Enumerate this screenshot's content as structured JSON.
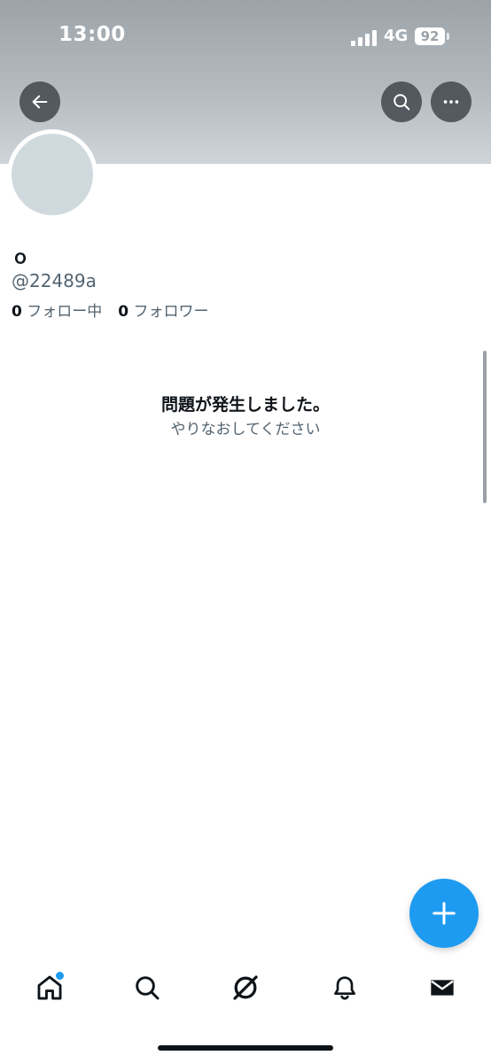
{
  "status_bar": {
    "time": "13:00",
    "network": "4G",
    "battery": "92"
  },
  "header": {
    "back_icon": "arrow-left-icon",
    "search_icon": "search-icon",
    "more_icon": "more-horizontal-icon"
  },
  "profile": {
    "display_name": "ｏ",
    "handle": "@22489a",
    "following_count": "0",
    "following_label": "フォロー中",
    "followers_count": "0",
    "followers_label": "フォロワー"
  },
  "error": {
    "title": "問題が発生しました。",
    "retry": "やりなおしてください"
  },
  "fab": {
    "icon": "plus-icon"
  },
  "tab_bar": {
    "items": [
      "home-icon",
      "search-icon",
      "grok-icon",
      "bell-icon",
      "mail-icon"
    ]
  },
  "colors": {
    "accent": "#1d9bf0",
    "text_primary": "#0f1419",
    "text_secondary": "#536471"
  }
}
